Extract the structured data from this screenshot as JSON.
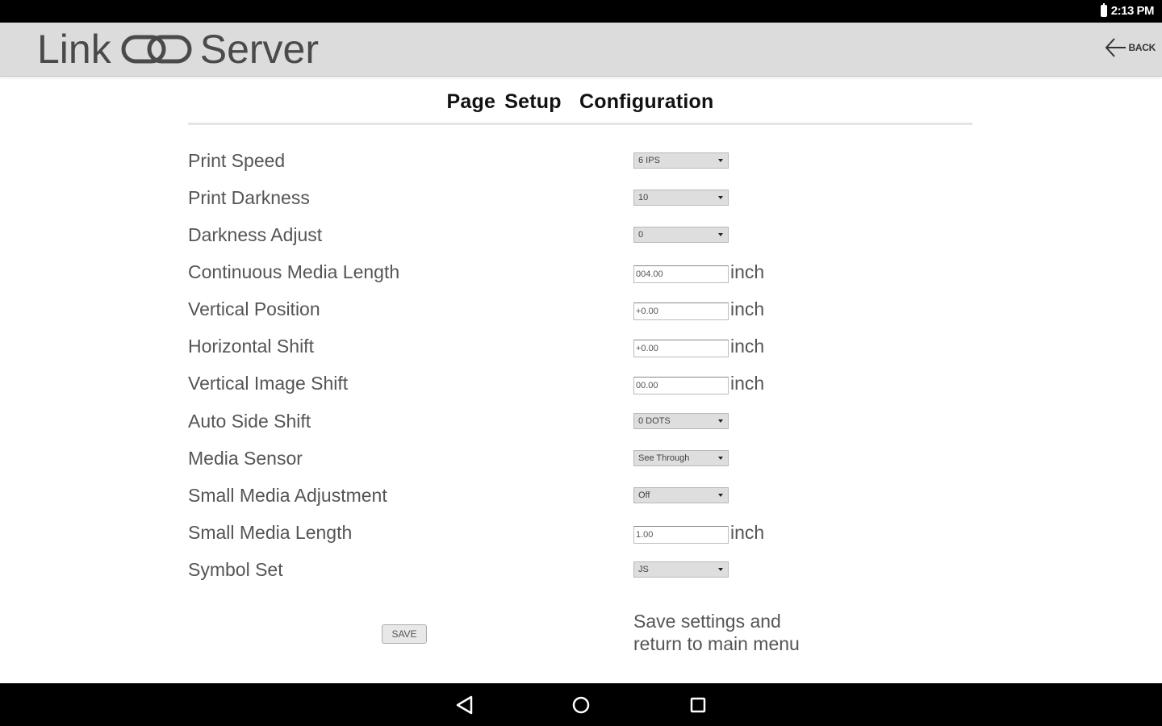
{
  "status_bar": {
    "time": "2:13 PM",
    "battery_icon": "battery-icon"
  },
  "app_bar": {
    "brand_left": "Link",
    "brand_right": "Server",
    "brand_icon": "chain-link-icon",
    "back_label": "BACK"
  },
  "page": {
    "title": "Page Setup  Configuration",
    "rows": [
      {
        "label": "Print Speed",
        "control": "select",
        "value": "6 IPS"
      },
      {
        "label": "Print Darkness",
        "control": "select",
        "value": "10"
      },
      {
        "label": "Darkness Adjust",
        "control": "select",
        "value": "0"
      },
      {
        "label": "Continuous Media Length",
        "control": "input",
        "value": "004.00",
        "unit": "inch"
      },
      {
        "label": "Vertical Position",
        "control": "input",
        "value": "+0.00",
        "unit": "inch"
      },
      {
        "label": "Horizontal Shift",
        "control": "input",
        "value": "+0.00",
        "unit": "inch"
      },
      {
        "label": "Vertical Image Shift",
        "control": "input",
        "value": "00.00",
        "unit": "inch"
      },
      {
        "label": "Auto Side Shift",
        "control": "select",
        "value": "0 DOTS"
      },
      {
        "label": "Media Sensor",
        "control": "select",
        "value": "See Through"
      },
      {
        "label": "Small Media Adjustment",
        "control": "select",
        "value": "Off"
      },
      {
        "label": "Small Media Length",
        "control": "input",
        "value": "1.00",
        "unit": "inch"
      },
      {
        "label": "Symbol Set",
        "control": "select",
        "value": "JS"
      }
    ],
    "save_button": "SAVE",
    "save_note_line1": "Save settings and",
    "save_note_line2": "return to main menu"
  },
  "nav_bar": {
    "back": "nav-back-icon",
    "home": "nav-home-icon",
    "recents": "nav-recents-icon"
  }
}
